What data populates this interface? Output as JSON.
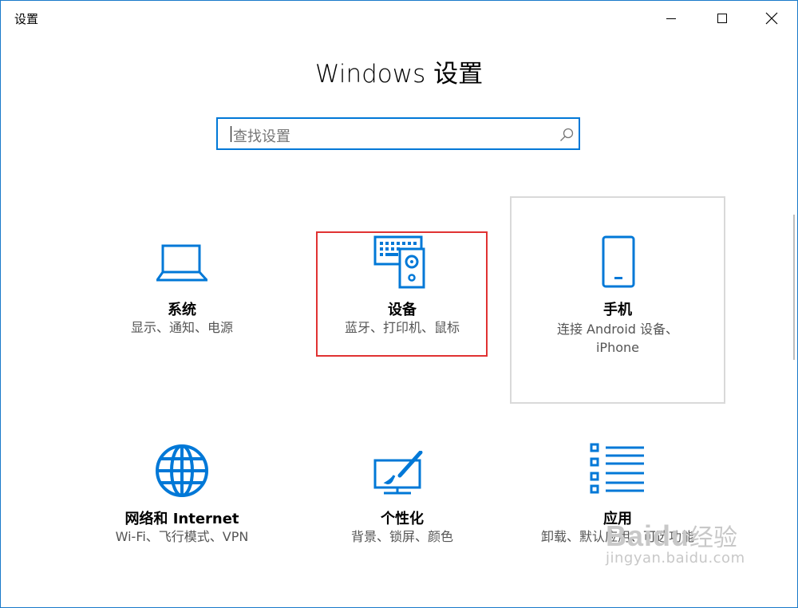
{
  "window": {
    "title": "设置"
  },
  "heading": "Windows 设置",
  "search": {
    "placeholder": "查找设置"
  },
  "tiles": [
    {
      "title": "系统",
      "desc": "显示、通知、电源",
      "icon": "laptop-icon"
    },
    {
      "title": "设备",
      "desc": "蓝牙、打印机、鼠标",
      "icon": "devices-icon"
    },
    {
      "title": "手机",
      "desc_line1": "连接 Android 设备、",
      "desc_line2": "iPhone",
      "icon": "phone-icon"
    },
    {
      "title": "网络和 Internet",
      "desc": "Wi-Fi、飞行模式、VPN",
      "icon": "globe-icon"
    },
    {
      "title": "个性化",
      "desc": "背景、锁屏、颜色",
      "icon": "paintbrush-icon"
    },
    {
      "title": "应用",
      "desc": "卸载、默认应用、可选功能",
      "icon": "apps-list-icon"
    }
  ],
  "watermark": {
    "logo": "Baidu",
    "cn": "经验",
    "url": "jingyan.baidu.com"
  },
  "colors": {
    "accent": "#0078d7",
    "highlight": "#e03232",
    "window_border": "#1979ca"
  }
}
